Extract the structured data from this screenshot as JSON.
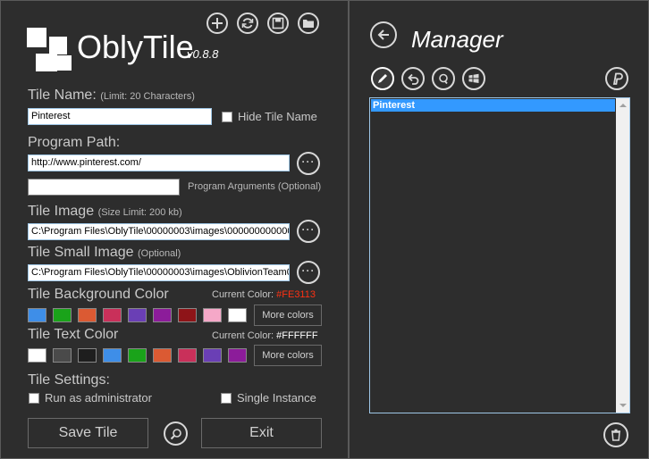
{
  "app": {
    "name": "OblyTile",
    "version": "v0.8.8"
  },
  "toolbar": {
    "icons": [
      "add-icon",
      "refresh-icon",
      "save-icon",
      "folder-icon"
    ]
  },
  "tile_name": {
    "label": "Tile Name:",
    "hint": "(Limit: 20 Characters)",
    "value": "Pinterest",
    "hide_label": "Hide Tile Name"
  },
  "program_path": {
    "label": "Program Path:",
    "value": "http://www.pinterest.com/",
    "args_value": "",
    "args_label": "Program Arguments (Optional)"
  },
  "tile_image": {
    "label": "Tile Image",
    "hint": "(Size Limit: 200 kb)",
    "value": "C:\\Program Files\\OblyTile\\00000003\\images\\000000000000"
  },
  "tile_small_image": {
    "label": "Tile Small Image",
    "hint": "(Optional)",
    "value": "C:\\Program Files\\OblyTile\\00000003\\images\\OblivionTeam0"
  },
  "bg_color": {
    "label": "Tile Background Color",
    "current_label": "Current Color:",
    "current_value": "#FE3113",
    "current_value_color": "#fe3113",
    "swatches": [
      "#3e8ee8",
      "#1aa31a",
      "#db5a33",
      "#c9305a",
      "#6a3fb5",
      "#8c1c9a",
      "#8e1418",
      "#f5a8c8",
      "#ffffff"
    ],
    "more_label": "More colors"
  },
  "text_color": {
    "label": "Tile Text Color",
    "current_label": "Current Color:",
    "current_value": "#FFFFFF",
    "current_value_color": "#ffffff",
    "swatches": [
      "#ffffff",
      "#4a4a4a",
      "#1e1e1e",
      "#3e8ee8",
      "#1aa31a",
      "#db5a33",
      "#c9305a",
      "#6a3fb5",
      "#8c1c9a"
    ],
    "more_label": "More colors"
  },
  "settings": {
    "label": "Tile Settings:",
    "run_admin": "Run as administrator",
    "single_instance": "Single Instance"
  },
  "buttons": {
    "save": "Save Tile",
    "exit": "Exit"
  },
  "manager": {
    "title": "Manager",
    "tool_icons": [
      "edit-icon",
      "undo-icon",
      "search-icon",
      "windows-icon"
    ],
    "paypal_icon": "paypal-icon",
    "items": [
      "Pinterest"
    ],
    "selected_color": "#3399ff"
  }
}
